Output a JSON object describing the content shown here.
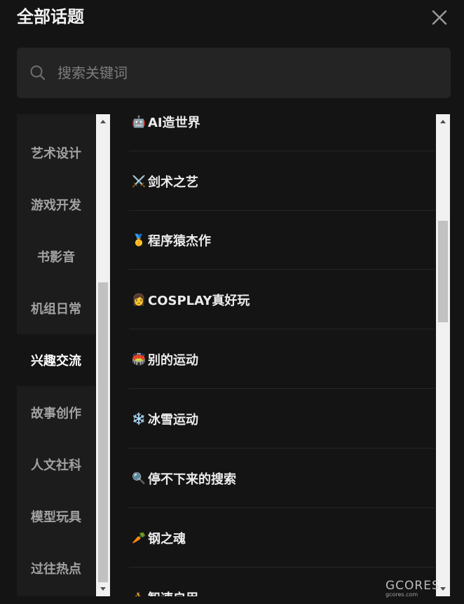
{
  "header": {
    "title": "全部话题"
  },
  "search": {
    "placeholder": "搜索关键词"
  },
  "categories": [
    {
      "label": "艺术设计"
    },
    {
      "label": "游戏开发"
    },
    {
      "label": "书影音"
    },
    {
      "label": "机组日常"
    },
    {
      "label": "兴趣交流"
    },
    {
      "label": "故事创作"
    },
    {
      "label": "人文社科"
    },
    {
      "label": "模型玩具"
    },
    {
      "label": "过往热点"
    }
  ],
  "active_category": "兴趣交流",
  "topics": [
    {
      "emoji": "🤖",
      "label": "AI造世界"
    },
    {
      "emoji": "⚔️",
      "label": "剑术之艺"
    },
    {
      "emoji": "🥇",
      "label": "程序猿杰作"
    },
    {
      "emoji": "👩",
      "label": "COSPLAY真好玩"
    },
    {
      "emoji": "🏟️",
      "label": "别的运动"
    },
    {
      "emoji": "❄️",
      "label": "冰雪运动"
    },
    {
      "emoji": "🔍",
      "label": "停不下来的搜索"
    },
    {
      "emoji": "🥕",
      "label": "钢之魂"
    },
    {
      "emoji": "🏃",
      "label": "智速启用"
    }
  ],
  "watermark": {
    "brand": "GCORES",
    "sub": "gcores.com"
  },
  "colors": {
    "background": "#141414",
    "panel": "#1c1c1c",
    "search_bg": "#242424",
    "scroll_track": "#f1f1f1",
    "scroll_thumb": "#c1c1c1"
  }
}
